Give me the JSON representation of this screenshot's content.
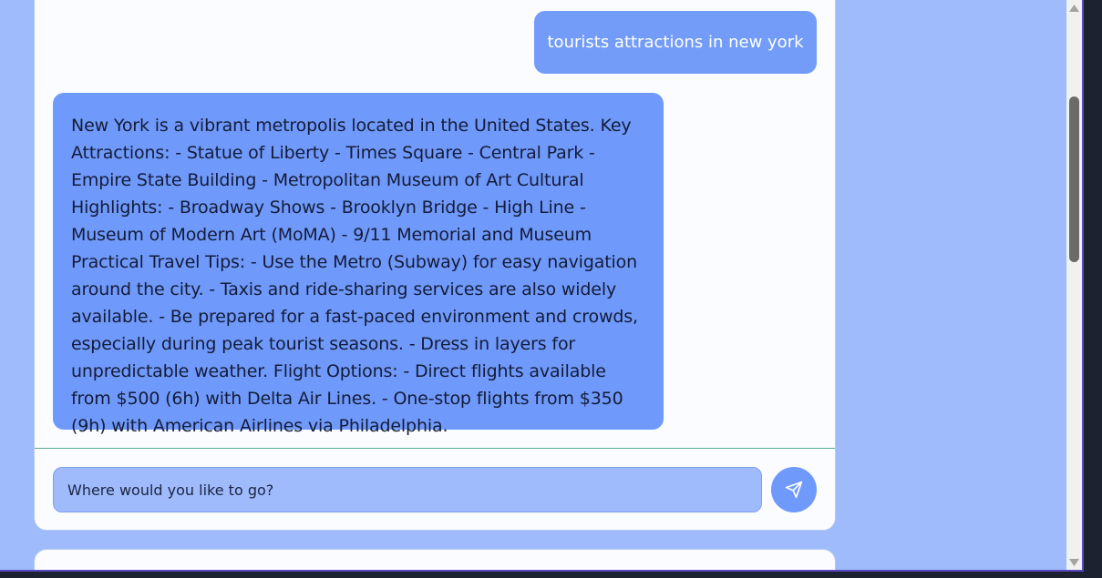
{
  "chat": {
    "user_message": "tourists attractions in new york",
    "assistant_message": "New York is a vibrant metropolis located in the United States. Key Attractions: - Statue of Liberty - Times Square - Central Park - Empire State Building - Metropolitan Museum of Art Cultural Highlights: - Broadway Shows - Brooklyn Bridge - High Line - Museum of Modern Art (MoMA) - 9/11 Memorial and Museum Practical Travel Tips: - Use the Metro (Subway) for easy navigation around the city. - Taxis and ride-sharing services are also widely available. - Be prepared for a fast-paced environment and crowds, especially during peak tourist seasons. - Dress in layers for unpredictable weather. Flight Options: - Direct flights available from $500 (6h) with Delta Air Lines. - One-stop flights from $350 (9h) with American Airlines via Philadelphia."
  },
  "composer": {
    "placeholder": "Where would you like to go?",
    "send_icon": "send-icon"
  },
  "colors": {
    "page_background": "#9fbbfc",
    "user_bubble": "#739cf9",
    "assistant_bubble": "#6f99fa",
    "card_background": "#fbfcff"
  }
}
